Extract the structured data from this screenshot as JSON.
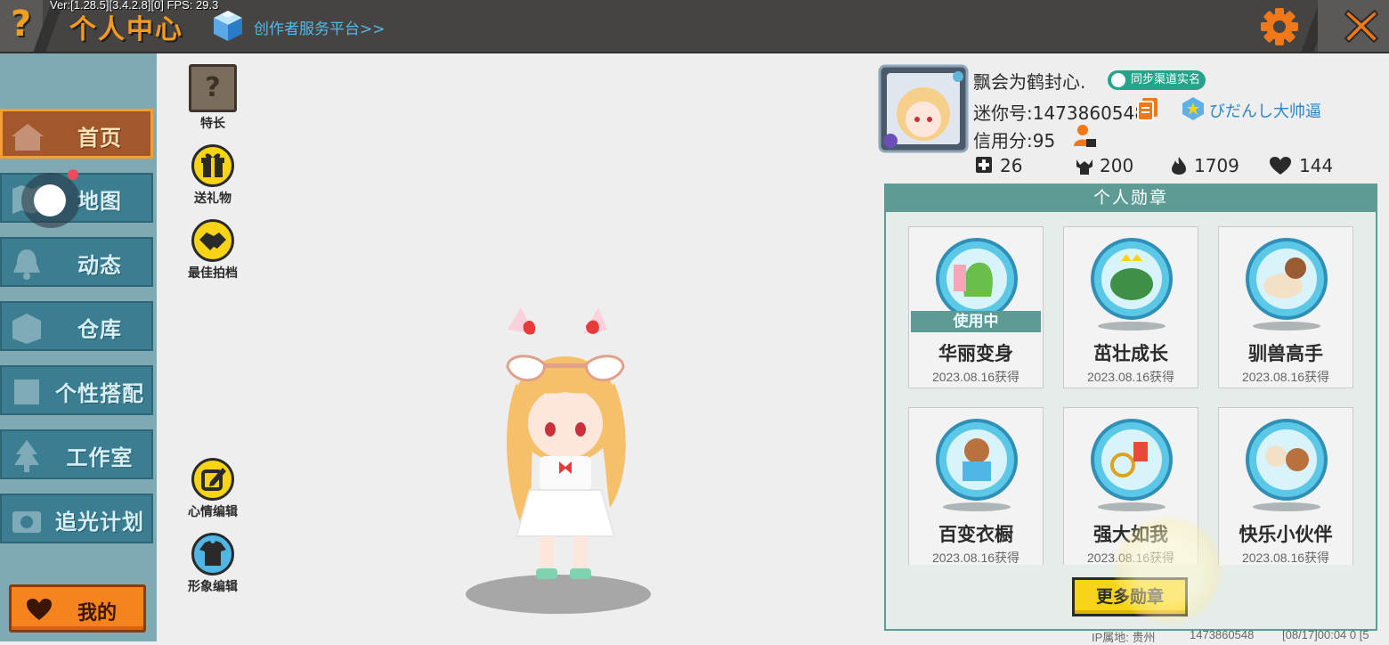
{
  "header": {
    "version_text": "Ver:[1.28.5][3.4.2.8][0] FPS: 29.3",
    "help_glyph": "?",
    "title": "个人中心",
    "creator_link": "创作者服务平台>>",
    "accent_color": "#f79a1e"
  },
  "sidebar": {
    "items": [
      {
        "label": "首页",
        "icon": "house-icon",
        "active": true
      },
      {
        "label": "地图",
        "icon": "map-icon",
        "active": false
      },
      {
        "label": "动态",
        "icon": "bell-icon",
        "active": false
      },
      {
        "label": "仓库",
        "icon": "box-icon",
        "active": false
      },
      {
        "label": "个性搭配",
        "icon": "outfit-icon",
        "active": false
      },
      {
        "label": "工作室",
        "icon": "tree-icon",
        "active": false
      },
      {
        "label": "追光计划",
        "icon": "camera-icon",
        "active": false
      }
    ],
    "mine_label": "我的"
  },
  "actions": {
    "specialty": "特长",
    "send_gift": "送礼物",
    "best_partner": "最佳拍档",
    "mood_edit": "心情编辑",
    "image_edit": "形象编辑"
  },
  "profile": {
    "nickname": "飘会为鹤封心.",
    "realname_badge": "同步渠道实名",
    "mini_id": "迷你号:1473860548",
    "team_name": "びだんし大帅逼",
    "credit": "信用分:95",
    "stats": {
      "add": "26",
      "fans": "200",
      "heat": "1709",
      "likes": "144"
    }
  },
  "medals": {
    "header": "个人勋章",
    "items": [
      {
        "name": "华丽变身",
        "date": "2023.08.16获得",
        "in_use": "使用中"
      },
      {
        "name": "茁壮成长",
        "date": "2023.08.16获得"
      },
      {
        "name": "驯兽高手",
        "date": "2023.08.16获得"
      },
      {
        "name": "百变衣橱",
        "date": "2023.08.16获得"
      },
      {
        "name": "强大如我",
        "date": "2023.08.16获得"
      },
      {
        "name": "快乐小伙伴",
        "date": "2023.08.16获得"
      }
    ],
    "more_button": "更多勋章"
  },
  "footer": {
    "ip_location": "IP属地: 贵州",
    "user_id": "1473860548",
    "timestamp": "[08/17]00:04 0 [5"
  }
}
